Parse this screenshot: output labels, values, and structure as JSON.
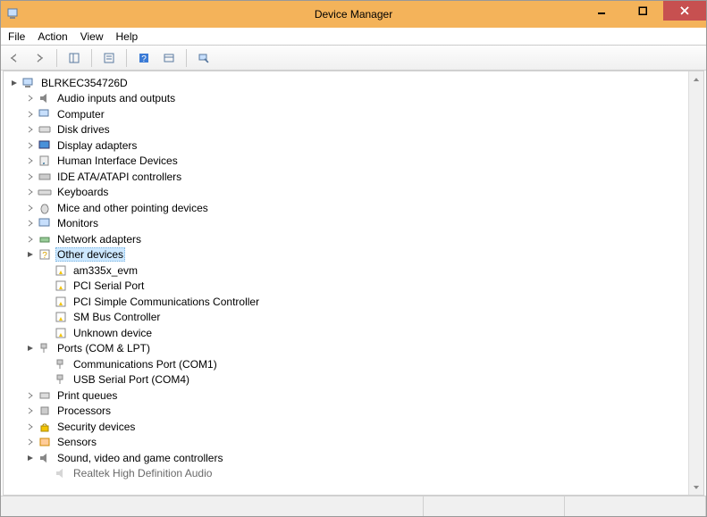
{
  "window": {
    "title": "Device Manager"
  },
  "menu": {
    "file": "File",
    "action": "Action",
    "view": "View",
    "help": "Help"
  },
  "tree": {
    "root": "BLRKEC354726D",
    "audio": "Audio inputs and outputs",
    "computer": "Computer",
    "disk": "Disk drives",
    "display": "Display adapters",
    "hid": "Human Interface Devices",
    "ide": "IDE ATA/ATAPI controllers",
    "keyboards": "Keyboards",
    "mice": "Mice and other pointing devices",
    "monitors": "Monitors",
    "network": "Network adapters",
    "other": "Other devices",
    "other_children": {
      "am335x": "am335x_evm",
      "pci_serial": "PCI Serial Port",
      "pci_simple": "PCI Simple Communications Controller",
      "smbus": "SM Bus Controller",
      "unknown": "Unknown device"
    },
    "ports": "Ports (COM & LPT)",
    "ports_children": {
      "com1": "Communications Port (COM1)",
      "com4": "USB Serial Port (COM4)"
    },
    "printq": "Print queues",
    "processors": "Processors",
    "security": "Security devices",
    "sensors": "Sensors",
    "sound": "Sound, video and game controllers",
    "sound_children": {
      "realtek": "Realtek High Definition Audio"
    }
  }
}
